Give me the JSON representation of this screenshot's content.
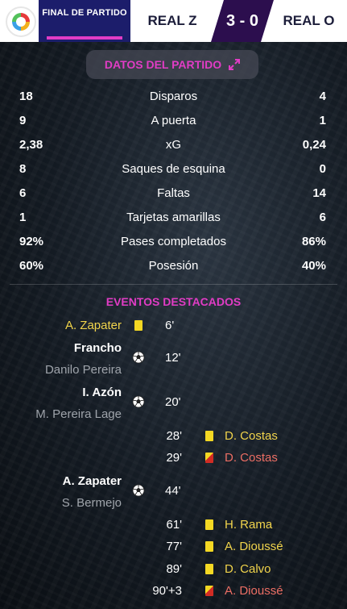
{
  "header": {
    "status": "FINAL DE PARTIDO",
    "home_team": "REAL Z",
    "score": "3 - 0",
    "away_team": "REAL O"
  },
  "stats_title": "DATOS DEL PARTIDO",
  "stats": [
    {
      "home": "18",
      "label": "Disparos",
      "away": "4"
    },
    {
      "home": "9",
      "label": "A puerta",
      "away": "1"
    },
    {
      "home": "2,38",
      "label": "xG",
      "away": "0,24"
    },
    {
      "home": "8",
      "label": "Saques de esquina",
      "away": "0"
    },
    {
      "home": "6",
      "label": "Faltas",
      "away": "14"
    },
    {
      "home": "1",
      "label": "Tarjetas amarillas",
      "away": "6"
    },
    {
      "home": "92%",
      "label": "Pases completados",
      "away": "86%"
    },
    {
      "home": "60%",
      "label": "Posesión",
      "away": "40%"
    }
  ],
  "events_title": "EVENTOS DESTACADOS",
  "events": [
    {
      "minute": "6'",
      "player": "A. Zapater",
      "type": "yellow-card"
    },
    {
      "minute": "12'",
      "player": "Francho",
      "assist": "Danilo Pereira",
      "type": "goal"
    },
    {
      "minute": "20'",
      "player": "I. Azón",
      "assist": "M. Pereira Lage",
      "type": "goal"
    },
    {
      "minute": "28'",
      "player": "D. Costas",
      "type": "yellow-card"
    },
    {
      "minute": "29'",
      "player": "D. Costas",
      "type": "second-yellow-red"
    },
    {
      "minute": "44'",
      "player": "A. Zapater",
      "assist": "S. Bermejo",
      "type": "goal"
    },
    {
      "minute": "61'",
      "player": "H. Rama",
      "type": "yellow-card"
    },
    {
      "minute": "77'",
      "player": "A. Dioussé",
      "type": "yellow-card"
    },
    {
      "minute": "89'",
      "player": "D. Calvo",
      "type": "yellow-card"
    },
    {
      "minute": "90'+3",
      "player": "A. Dioussé",
      "type": "second-yellow-red"
    }
  ],
  "colors": {
    "accent": "#e13cc5",
    "header_dark": "#1c1d6b",
    "score_bg": "#2c0e4e",
    "yellow_card": "#f4d823",
    "red_card": "#d12c24",
    "sent_off_text": "#ec6e64",
    "booked_text": "#f1d44c"
  },
  "icons": {
    "league": "league-logo-icon",
    "expand": "expand-icon",
    "goal": "football-icon",
    "yellow_card": "yellow-card-icon",
    "red_card": "red-card-icon"
  }
}
